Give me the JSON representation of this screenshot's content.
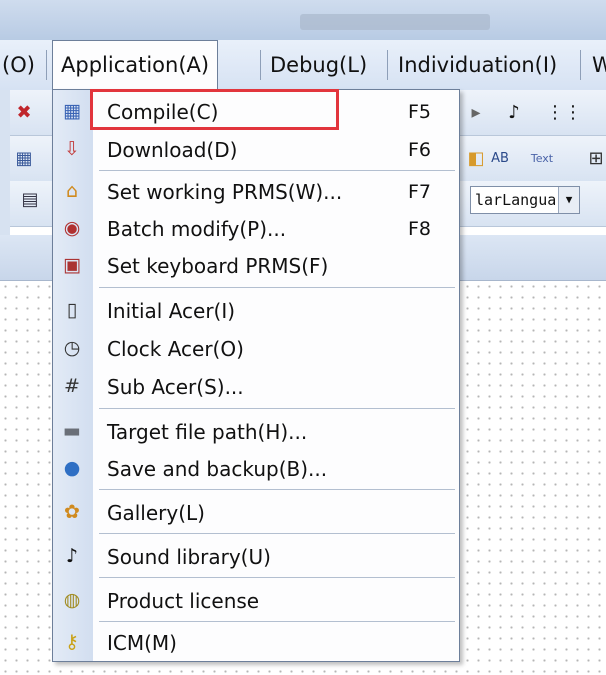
{
  "menubar": {
    "items": [
      {
        "label": "(O)"
      },
      {
        "label": "Application(A)"
      },
      {
        "label": "Debug(L)"
      },
      {
        "label": "Individuation(I)"
      },
      {
        "label": "W"
      }
    ]
  },
  "toolbar": {
    "combo_value": "larLangua"
  },
  "dropdown": {
    "items": [
      {
        "label": "Compile(C)",
        "shortcut": "F5",
        "icon": "compile-icon"
      },
      {
        "label": "Download(D)",
        "shortcut": "F6",
        "icon": "download-icon"
      },
      {
        "label": "Set working PRMS(W)...",
        "shortcut": "F7",
        "icon": "home-icon"
      },
      {
        "label": "Batch modify(P)...",
        "shortcut": "F8",
        "icon": "batch-modify-icon"
      },
      {
        "label": "Set keyboard PRMS(F)",
        "shortcut": "",
        "icon": "keyboard-icon"
      },
      {
        "label": "Initial Acer(I)",
        "shortcut": "",
        "icon": "initial-acer-icon"
      },
      {
        "label": "Clock Acer(O)",
        "shortcut": "",
        "icon": "clock-acer-icon"
      },
      {
        "label": "Sub Acer(S)...",
        "shortcut": "",
        "icon": "sub-acer-icon"
      },
      {
        "label": "Target file path(H)...",
        "shortcut": "",
        "icon": "drive-icon"
      },
      {
        "label": "Save and backup(B)...",
        "shortcut": "",
        "icon": "backup-icon"
      },
      {
        "label": "Gallery(L)",
        "shortcut": "",
        "icon": "gallery-icon"
      },
      {
        "label": "Sound library(U)",
        "shortcut": "",
        "icon": "music-note-icon"
      },
      {
        "label": "Product license",
        "shortcut": "",
        "icon": "coins-icon"
      },
      {
        "label": "ICM(M)",
        "shortcut": "",
        "icon": "key-icon"
      }
    ]
  },
  "colors": {
    "highlight_border": "#e2353d",
    "menu_bg": "#fdfdfe",
    "icon_column": "#d2def0"
  }
}
